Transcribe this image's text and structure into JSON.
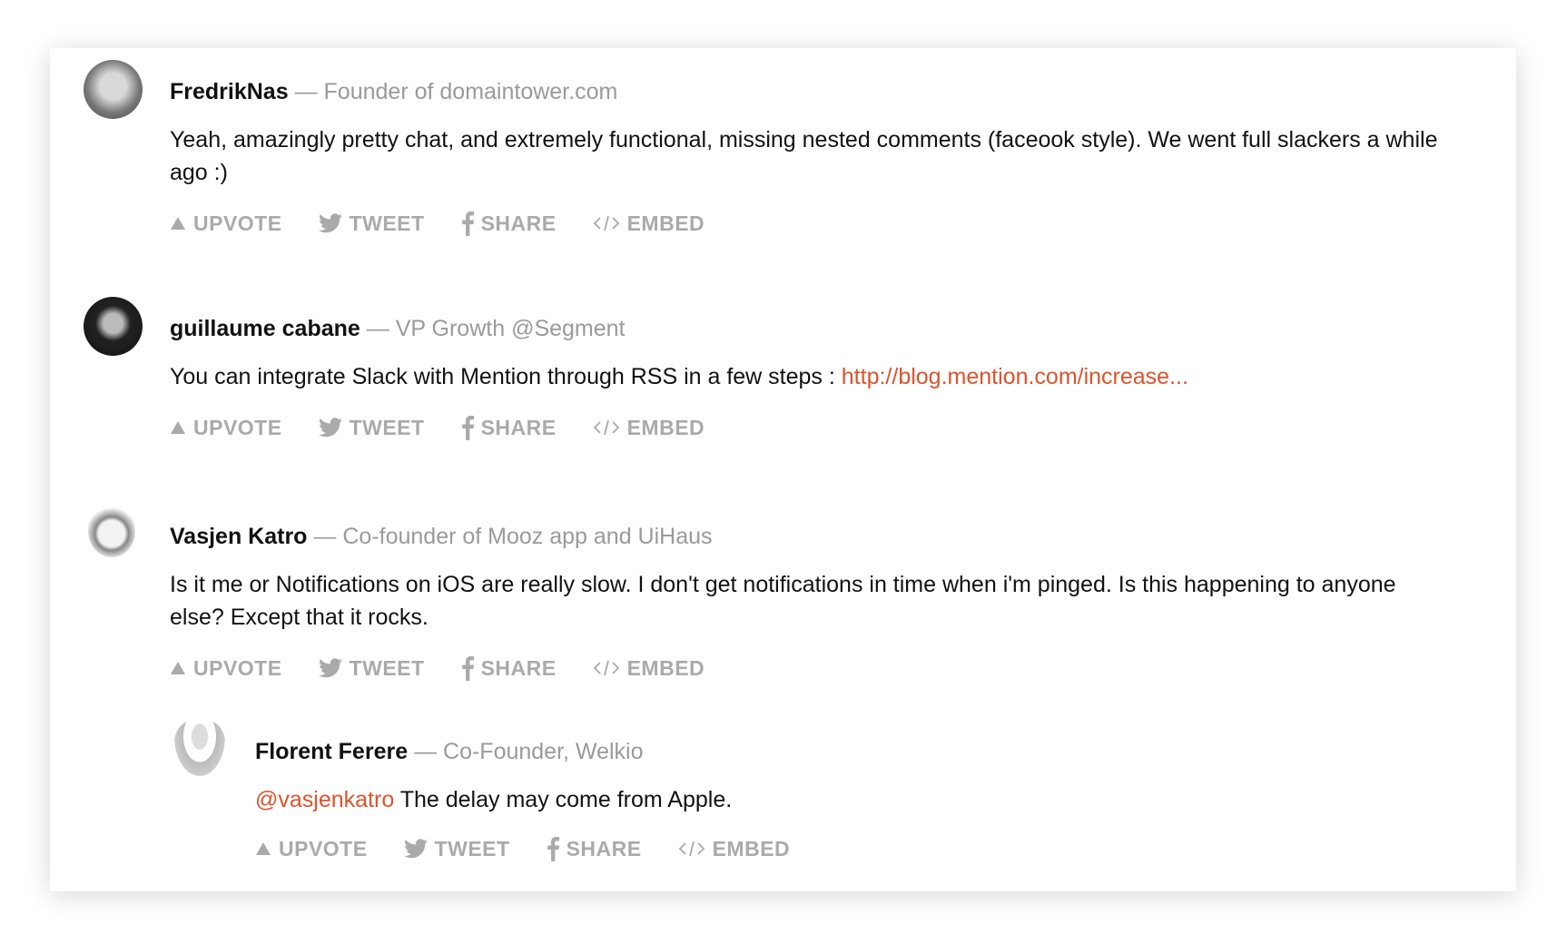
{
  "actions": {
    "upvote": "UPVOTE",
    "tweet": "TWEET",
    "share": "SHARE",
    "embed": "EMBED"
  },
  "comments": [
    {
      "name": "FredrikNas",
      "role": "— Founder of domaintower.com",
      "text": "Yeah, amazingly pretty chat, and extremely functional, missing nested comments (faceook style). We went full slackers a while ago :)"
    },
    {
      "name": "guillaume cabane",
      "role": "— VP Growth @Segment",
      "text": "You can integrate Slack with Mention through RSS in a few steps : ",
      "link": "http://blog.mention.com/increase..."
    },
    {
      "name": "Vasjen Katro",
      "role": "— Co-founder of Mooz app and UiHaus",
      "text": "Is it me or Notifications on iOS are really slow. I don't get notifications in time when i'm pinged. Is this happening to anyone else? Except that it rocks."
    },
    {
      "name": "Florent Ferere",
      "role": "— Co-Founder, Welkio",
      "mention": "@vasjenkatro",
      "text": " The delay may come from Apple."
    }
  ],
  "colors": {
    "accent": "#e0522b",
    "muted": "#aaaaaa"
  }
}
